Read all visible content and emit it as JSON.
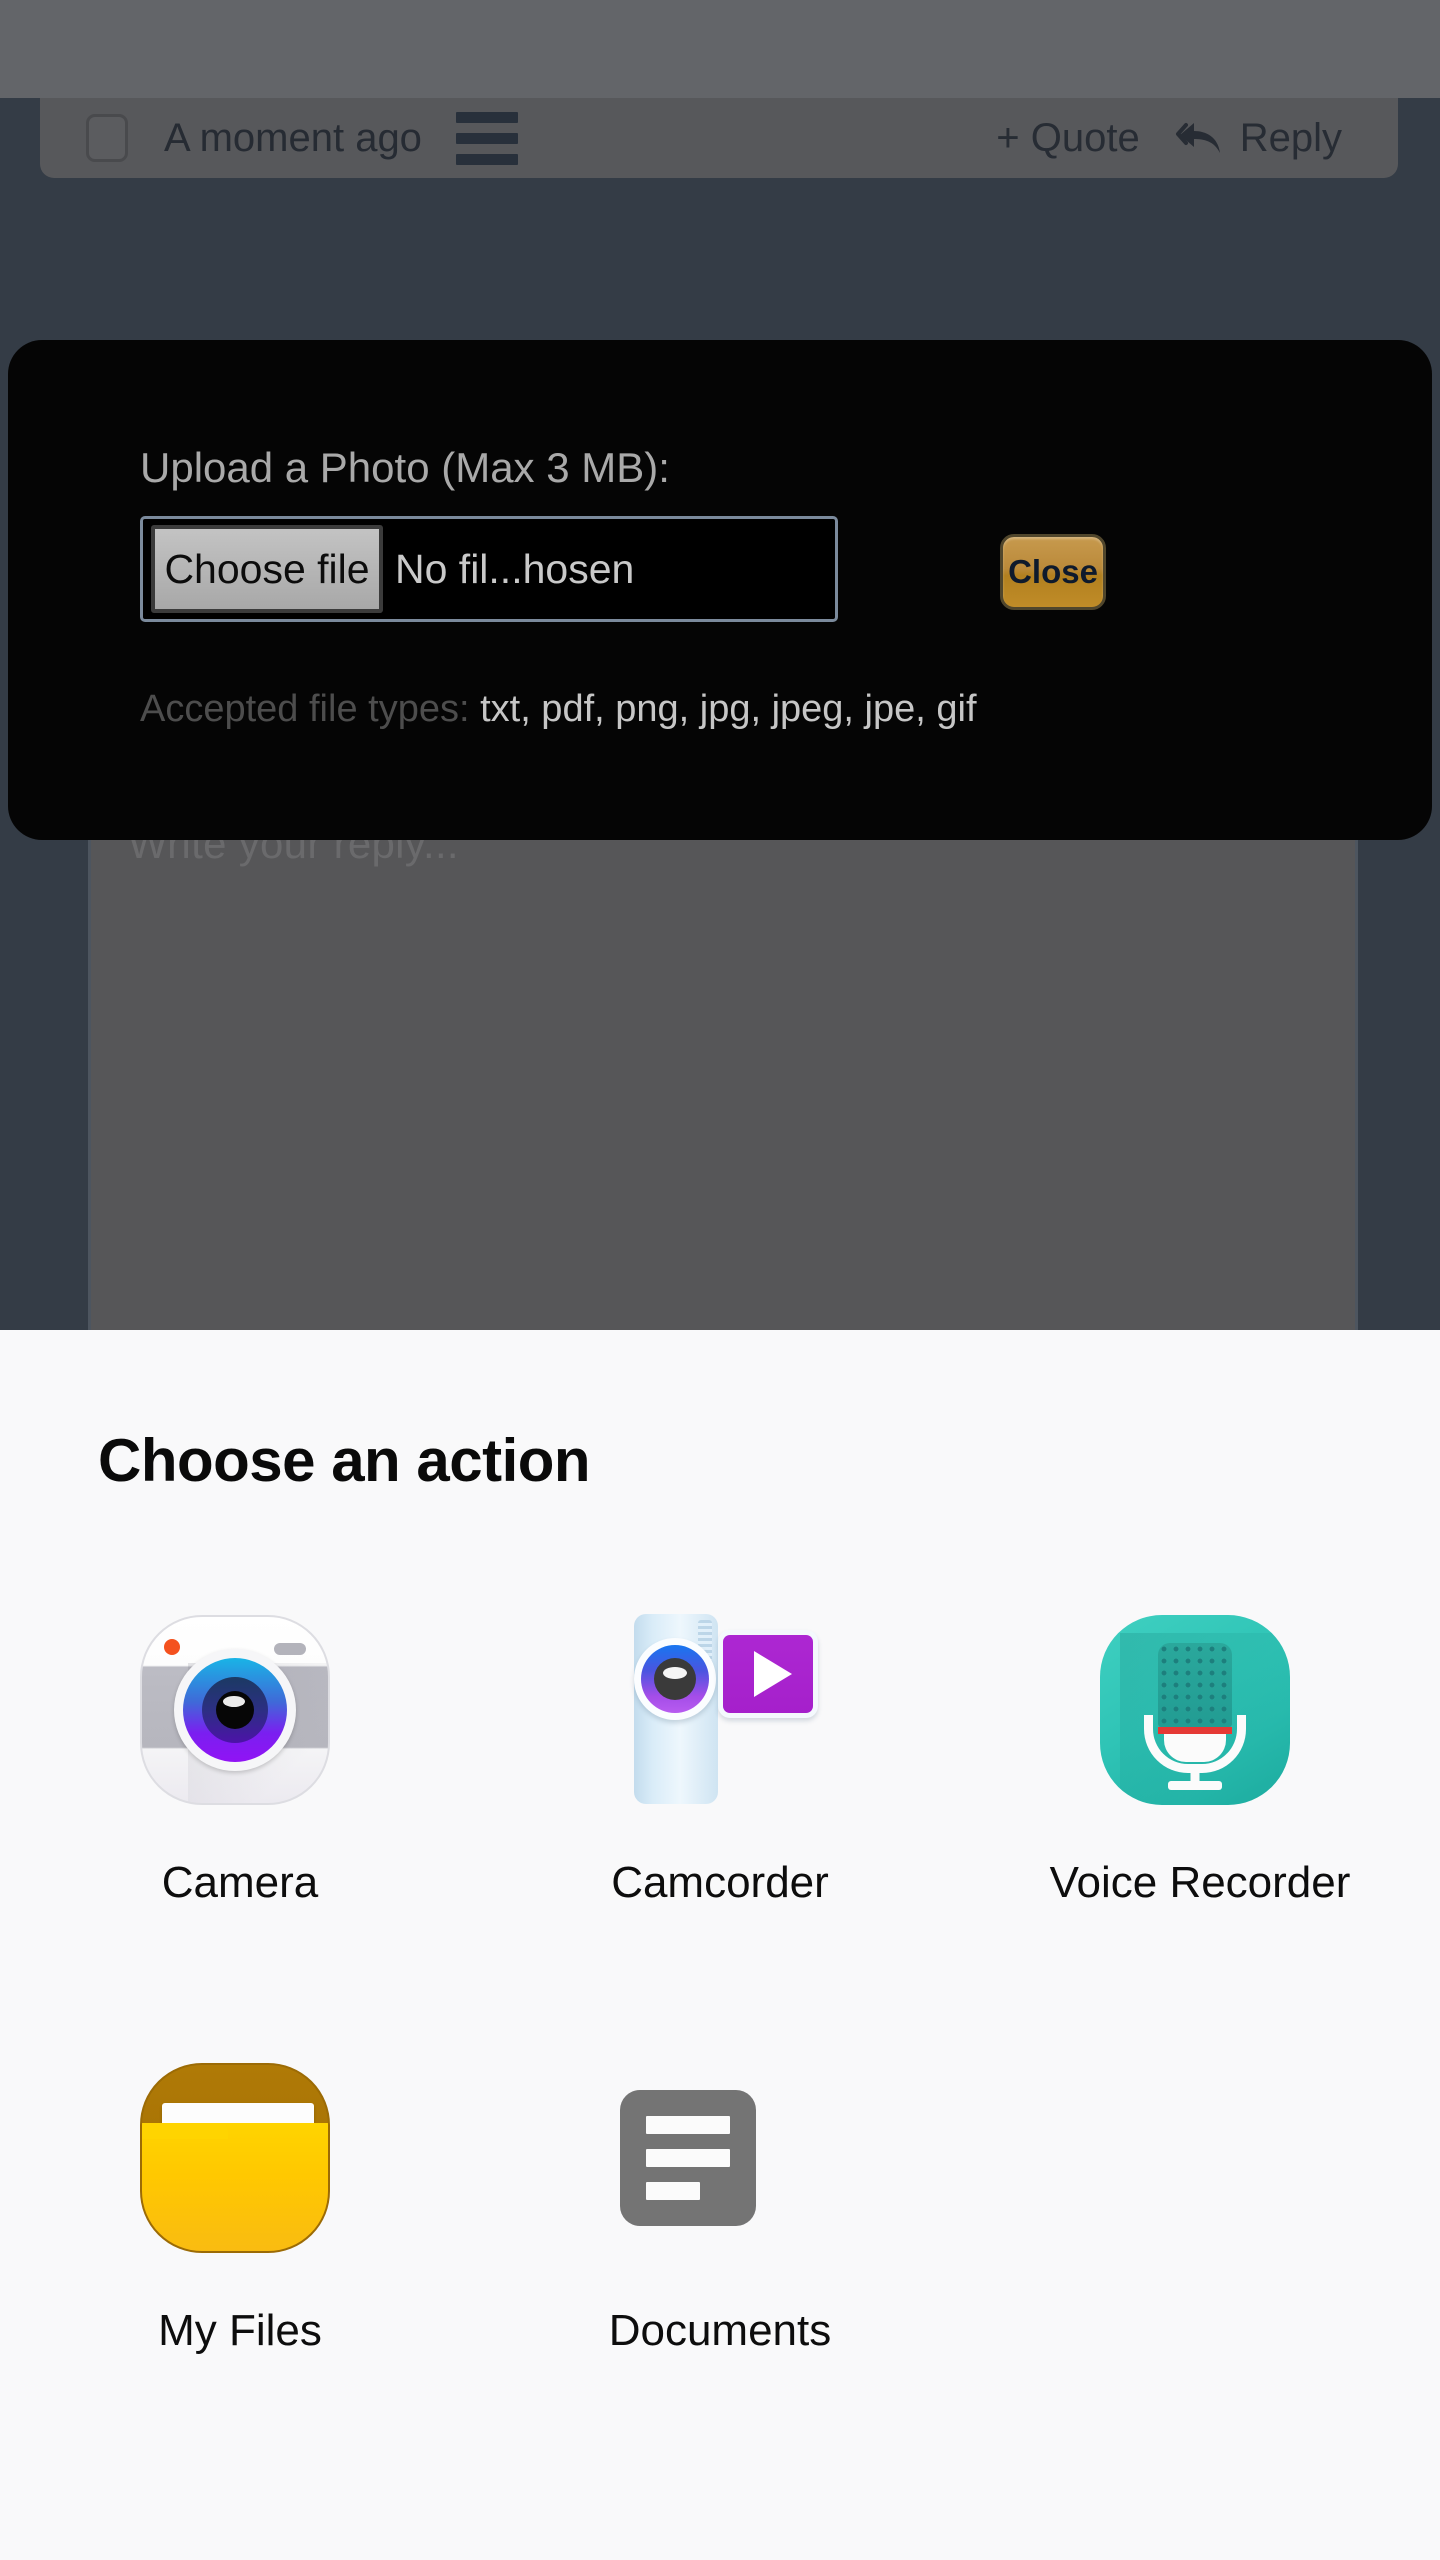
{
  "background_page": {
    "post_bar": {
      "checkbox_name": "post-select-checkbox",
      "timestamp": "A moment ago",
      "menu_icon": "hamburger-icon",
      "quote_label": "+ Quote",
      "reply_label": "Reply",
      "reply_icon": "reply-arrow-icon"
    },
    "reply_editor": {
      "placeholder": "Write your reply..."
    }
  },
  "upload_dialog": {
    "label": "Upload a Photo (Max 3 MB):",
    "file_input": {
      "button_label": "Choose file",
      "file_status": "No fil...hosen"
    },
    "close_label": "Close",
    "accepted_lead": "Accepted file types:",
    "accepted_list": "txt, pdf, png, jpg, jpeg, jpe, gif",
    "colors": {
      "panel_bg": "#050505",
      "close_button": "#bb8a3a",
      "focus_ring": "#7b8a9c"
    }
  },
  "action_sheet": {
    "title": "Choose an action",
    "background": "#f9f9fa",
    "rows": [
      [
        {
          "label": "Camera",
          "icon": "camera-icon"
        },
        {
          "label": "Camcorder",
          "icon": "camcorder-icon"
        },
        {
          "label": "Voice Recorder",
          "icon": "voice-recorder-icon"
        }
      ],
      [
        {
          "label": "My Files",
          "icon": "folder-icon"
        },
        {
          "label": "Documents",
          "icon": "documents-icon"
        }
      ]
    ]
  }
}
